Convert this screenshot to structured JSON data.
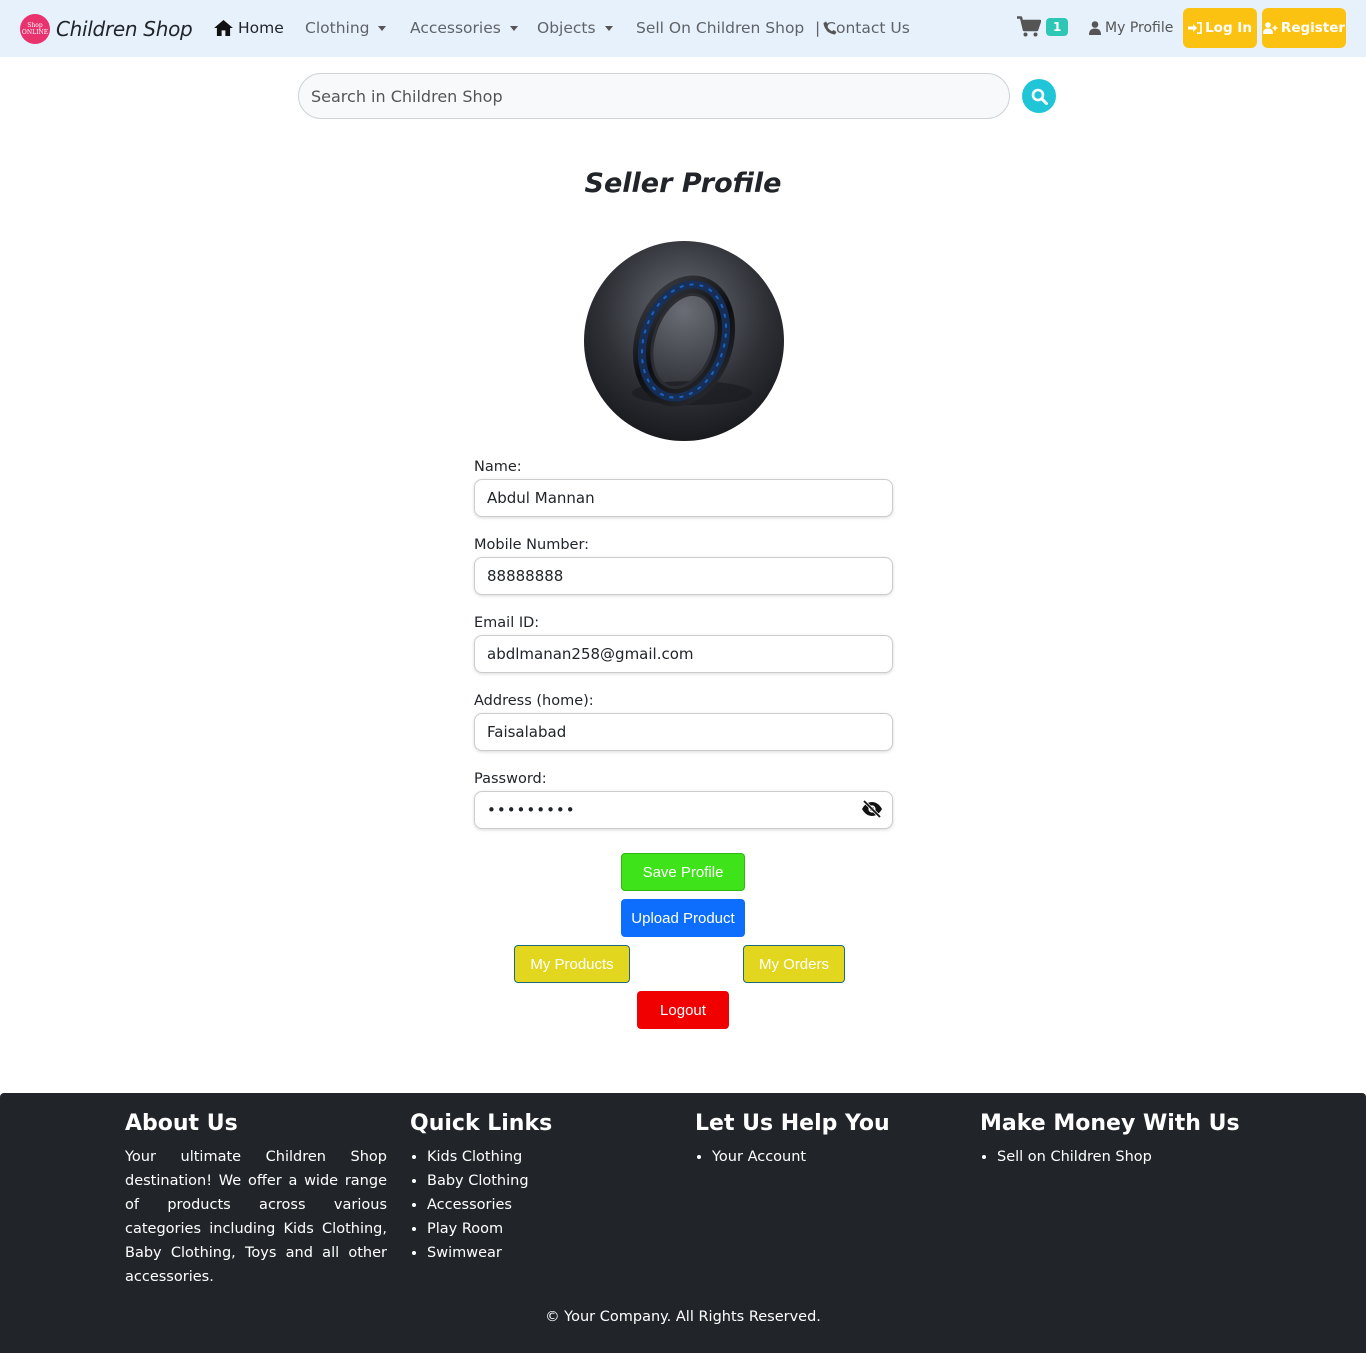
{
  "brand": {
    "logo_text": "Shop ONLINE",
    "name": "Children Shop"
  },
  "nav": {
    "home": "Home",
    "clothing": "Clothing",
    "accessories": "Accessories",
    "objects": "Objects",
    "sell": "Sell On Children Shop",
    "contact": "| Contact Us",
    "cart_count": "1",
    "my_profile": "My Profile",
    "login": "Log In",
    "register": "Register"
  },
  "search": {
    "placeholder": "Search in Children Shop"
  },
  "page": {
    "title": "Seller Profile"
  },
  "form": {
    "name_label": "Name:",
    "name_value": "Abdul Mannan",
    "mobile_label": "Mobile Number:",
    "mobile_value": "88888888",
    "email_label": "Email ID:",
    "email_value": "abdlmanan258@gmail.com",
    "address_label": "Address (home):",
    "address_value": "Faisalabad",
    "password_label": "Password:",
    "password_value": "•••••••••"
  },
  "actions": {
    "save": "Save Profile",
    "upload": "Upload Product",
    "my_products": "My Products",
    "my_orders": "My Orders",
    "logout": "Logout"
  },
  "footer": {
    "about_title": "About Us",
    "about_text": "Your ultimate Children Shop destination! We offer a wide range of products across various categories including Kids Clothing, Baby Clothing, Toys and all other accessories.",
    "quick_title": "Quick Links",
    "quick_links": [
      "Kids Clothing",
      "Baby Clothing",
      "Accessories",
      "Play Room",
      "Swimwear"
    ],
    "help_title": "Let Us Help You",
    "help_links": [
      "Your Account"
    ],
    "money_title": "Make Money With Us",
    "money_links": [
      "Sell on Children Shop"
    ],
    "copyright": "© Your Company. All Rights Reserved."
  },
  "colors": {
    "navbar_bg": "#e7f1fb",
    "auth_buttons": "#fcc212",
    "cart_badge": "#2ec7b6",
    "search_button": "#20c6d8",
    "save_button": "#3fe31a",
    "upload_button": "#0d6efd",
    "secondary_buttons": "#e3d61e",
    "logout_button": "#f00000",
    "footer_bg": "#212529"
  },
  "icons": [
    "home-icon",
    "phone-icon",
    "cart-icon",
    "user-icon",
    "login-icon",
    "user-plus-icon",
    "search-icon",
    "eye-slash-icon"
  ]
}
